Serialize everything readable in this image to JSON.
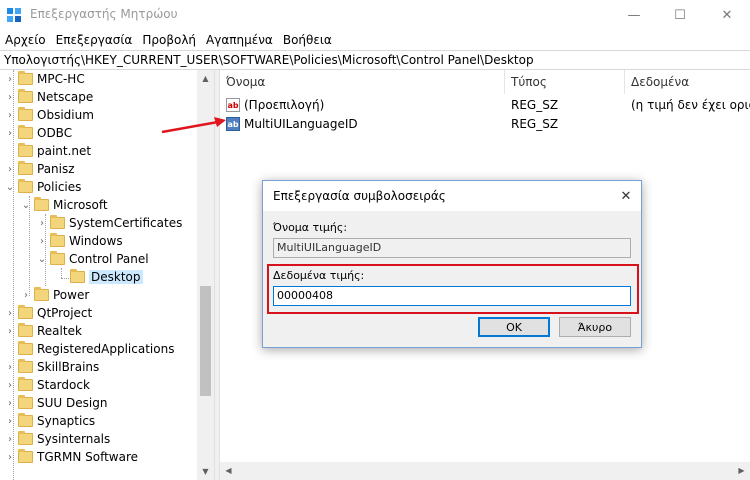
{
  "window": {
    "title": "Επεξεργαστής Μητρώου",
    "minimize": "—",
    "maximize": "☐",
    "close": "✕"
  },
  "menu": [
    "Αρχείο",
    "Επεξεργασία",
    "Προβολή",
    "Αγαπημένα",
    "Βοήθεια"
  ],
  "address": "Υπολογιστής\\HKEY_CURRENT_USER\\SOFTWARE\\Policies\\Microsoft\\Control Panel\\Desktop",
  "tree": [
    {
      "label": "MPC-HC",
      "chev": "›"
    },
    {
      "label": "Netscape",
      "chev": "›"
    },
    {
      "label": "Obsidium",
      "chev": "›"
    },
    {
      "label": "ODBC",
      "chev": "›"
    },
    {
      "label": "paint.net",
      "chev": ""
    },
    {
      "label": "Panisz",
      "chev": "›"
    },
    {
      "label": "Policies",
      "chev": "⌄"
    },
    {
      "label": "Microsoft",
      "chev": "⌄"
    },
    {
      "label": "SystemCertificates",
      "chev": "›"
    },
    {
      "label": "Windows",
      "chev": "›"
    },
    {
      "label": "Control Panel",
      "chev": "⌄"
    },
    {
      "label": "Desktop",
      "chev": ""
    },
    {
      "label": "Power",
      "chev": "›"
    },
    {
      "label": "QtProject",
      "chev": "›"
    },
    {
      "label": "Realtek",
      "chev": "›"
    },
    {
      "label": "RegisteredApplications",
      "chev": ""
    },
    {
      "label": "SkillBrains",
      "chev": "›"
    },
    {
      "label": "Stardock",
      "chev": "›"
    },
    {
      "label": "SUU Design",
      "chev": "›"
    },
    {
      "label": "Synaptics",
      "chev": "›"
    },
    {
      "label": "Sysinternals",
      "chev": "›"
    },
    {
      "label": "TGRMN Software",
      "chev": "›"
    }
  ],
  "list": {
    "headers": {
      "name": "Όνομα",
      "type": "Τύπος",
      "data": "Δεδομένα"
    },
    "rows": [
      {
        "icon": "ab",
        "name": "(Προεπιλογή)",
        "type": "REG_SZ",
        "data": "(η τιμή δεν έχει οριστεί)"
      },
      {
        "icon": "ab",
        "name": "MultiUILanguageID",
        "type": "REG_SZ",
        "data": ""
      }
    ]
  },
  "dialog": {
    "title": "Επεξεργασία συμβολοσειράς",
    "close": "✕",
    "name_label": "Όνομα τιμής:",
    "name_value": "MultiUILanguageID",
    "data_label": "Δεδομένα τιμής:",
    "data_value": "00000408",
    "ok": "OK",
    "cancel": "Άκυρο"
  },
  "colors": {
    "accent": "#0078d7",
    "highlight": "#d8121b",
    "folder": "#f3d57b",
    "selection": "#cce8ff"
  }
}
